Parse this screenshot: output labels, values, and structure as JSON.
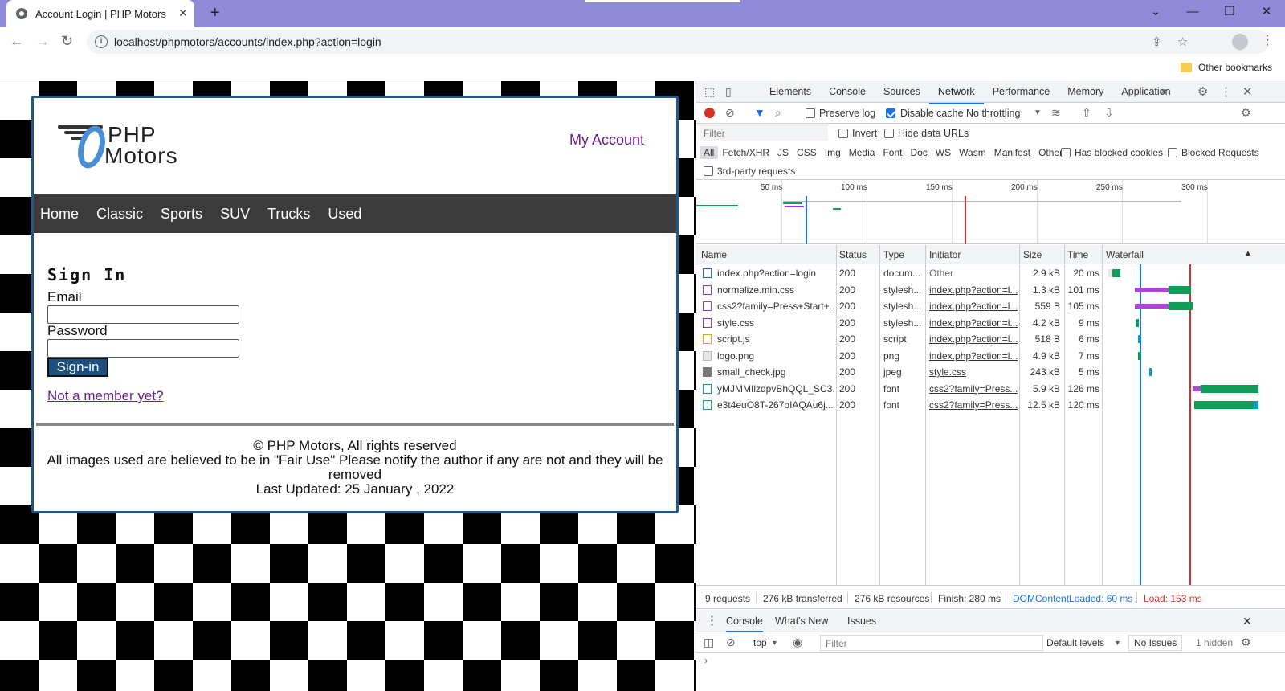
{
  "browser": {
    "tab_title": "Account Login | PHP Motors",
    "tab_close": "✕",
    "new_tab": "+",
    "window_controls": [
      "⌄",
      "—",
      "❐",
      "✕"
    ],
    "url": "localhost/phpmotors/accounts/index.php?action=login",
    "bookmark": "Other bookmarks"
  },
  "site": {
    "logo_line1": "PHP",
    "logo_line2": "Motors",
    "my_account": "My Account",
    "nav": [
      "Home",
      "Classic",
      "Sports",
      "SUV",
      "Trucks",
      "Used"
    ],
    "heading": "Sign In",
    "email_label": "Email",
    "password_label": "Password",
    "signin_button": "Sign-in",
    "not_member": "Not a member yet?",
    "footer_line1": "© PHP Motors, All rights reserved",
    "footer_line2": "All images used are believed to be in \"Fair Use\" Please notify the author if any are not and they will be removed",
    "footer_line3": "Last Updated: 25 January , 2022"
  },
  "devtools": {
    "tabs": [
      "Elements",
      "Console",
      "Sources",
      "Network",
      "Performance",
      "Memory",
      "Application"
    ],
    "active_tab": "Network",
    "preserve_log": "Preserve log",
    "disable_cache": "Disable cache",
    "throttling": "No throttling",
    "filter_placeholder": "Filter",
    "invert": "Invert",
    "hide_data_urls": "Hide data URLs",
    "types": [
      "All",
      "Fetch/XHR",
      "JS",
      "CSS",
      "Img",
      "Media",
      "Font",
      "Doc",
      "WS",
      "Wasm",
      "Manifest",
      "Other"
    ],
    "has_blocked_cookies": "Has blocked cookies",
    "blocked_requests": "Blocked Requests",
    "third_party": "3rd-party requests",
    "overview_ticks": [
      "50 ms",
      "100 ms",
      "150 ms",
      "200 ms",
      "250 ms",
      "300 ms"
    ],
    "columns": [
      "Name",
      "Status",
      "Type",
      "Initiator",
      "Size",
      "Time",
      "Waterfall"
    ],
    "rows": [
      {
        "name": "index.php?action=login",
        "status": "200",
        "type": "docum...",
        "initiator": "Other",
        "size": "2.9 kB",
        "time": "20 ms"
      },
      {
        "name": "normalize.min.css",
        "status": "200",
        "type": "stylesh...",
        "initiator": "index.php?action=l...",
        "size": "1.3 kB",
        "time": "101 ms"
      },
      {
        "name": "css2?family=Press+Start+...",
        "status": "200",
        "type": "stylesh...",
        "initiator": "index.php?action=l...",
        "size": "559 B",
        "time": "105 ms"
      },
      {
        "name": "style.css",
        "status": "200",
        "type": "stylesh...",
        "initiator": "index.php?action=l...",
        "size": "4.2 kB",
        "time": "9 ms"
      },
      {
        "name": "script.js",
        "status": "200",
        "type": "script",
        "initiator": "index.php?action=l...",
        "size": "518 B",
        "time": "6 ms"
      },
      {
        "name": "logo.png",
        "status": "200",
        "type": "png",
        "initiator": "index.php?action=l...",
        "size": "4.9 kB",
        "time": "7 ms"
      },
      {
        "name": "small_check.jpg",
        "status": "200",
        "type": "jpeg",
        "initiator": "style.css",
        "size": "243 kB",
        "time": "5 ms"
      },
      {
        "name": "yMJMMIlzdpvBhQQL_SC3...",
        "status": "200",
        "type": "font",
        "initiator": "css2?family=Press...",
        "size": "5.9 kB",
        "time": "126 ms"
      },
      {
        "name": "e3t4euO8T-267oIAQAu6j...",
        "status": "200",
        "type": "font",
        "initiator": "css2?family=Press...",
        "size": "12.5 kB",
        "time": "120 ms"
      }
    ],
    "summary": {
      "requests": "9 requests",
      "transferred": "276 kB transferred",
      "resources": "276 kB resources",
      "finish": "Finish: 280 ms",
      "dcl": "DOMContentLoaded: 60 ms",
      "load": "Load: 153 ms"
    },
    "drawer_tabs": [
      "Console",
      "What's New",
      "Issues"
    ],
    "console_context": "top",
    "console_filter": "Filter",
    "default_levels": "Default levels",
    "no_issues": "No Issues",
    "hidden": "1 hidden",
    "colors": {
      "accent": "#1a73e8",
      "record": "#d93025",
      "dcl": "#1a73e8",
      "load": "#d93025",
      "purple": "#6a1e8c",
      "navy": "#1d5990"
    }
  }
}
